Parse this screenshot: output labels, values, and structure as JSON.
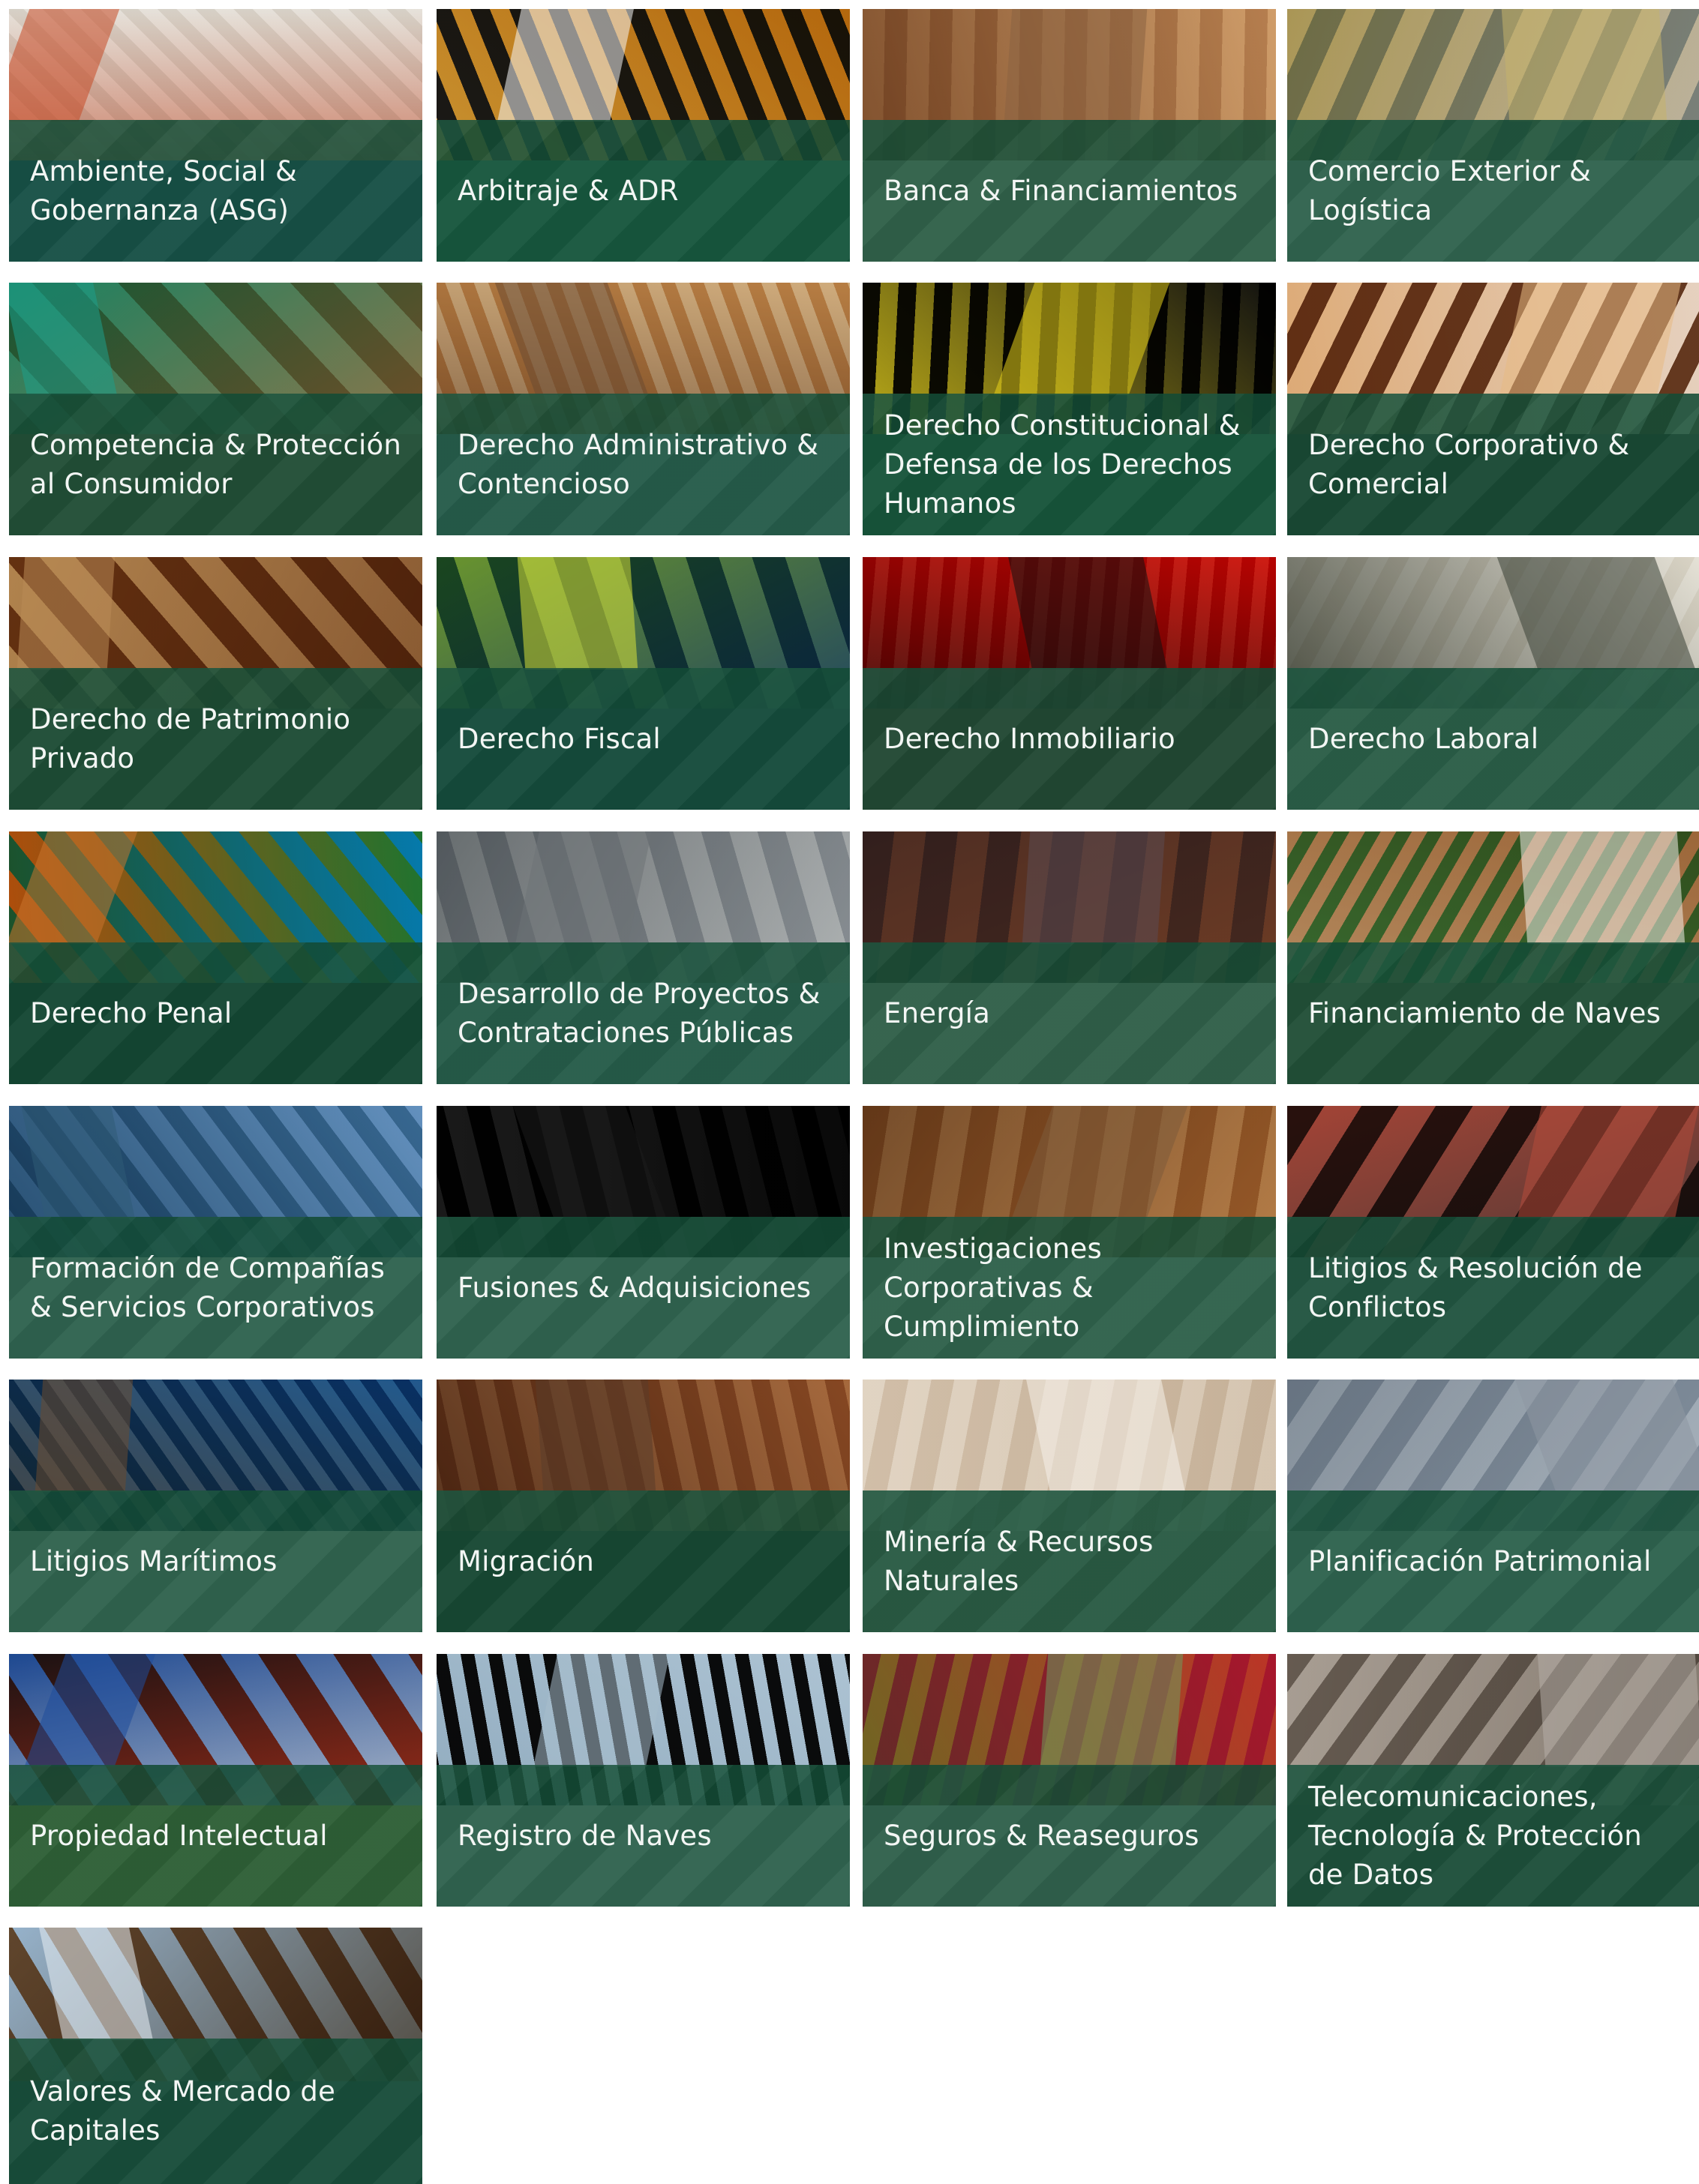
{
  "practice_areas": [
    {
      "label": "Ambiente, Social & Gobernanza (ASG)",
      "image_icon": "texture-mosaic-icon",
      "colors": [
        "#f2f0ec",
        "#e2ded7",
        "#c64a27",
        "#2d5fa8"
      ]
    },
    {
      "label": "Arbitraje & ADR",
      "image_icon": "halftone-stripes-icon",
      "colors": [
        "#d6a23a",
        "#1c1c1c",
        "#f4f4f4",
        "#2f8a66"
      ]
    },
    {
      "label": "Banca & Financiamientos",
      "image_icon": "wood-panel-icon",
      "colors": [
        "#e6c8a4",
        "#caa27b",
        "#8a6242",
        "#f2dcc1"
      ]
    },
    {
      "label": "Comercio Exterior & Logística",
      "image_icon": "architecture-icon",
      "colors": [
        "#dcd7cc",
        "#8e9aa0",
        "#c5b26b",
        "#f3f1ea"
      ]
    },
    {
      "label": "Competencia & Protección al Consumidor",
      "image_icon": "sculpture-icon",
      "colors": [
        "#b98c61",
        "#e8d0b3",
        "#1d9f8a",
        "#7a4d2f"
      ]
    },
    {
      "label": "Derecho Administrativo & Contencioso",
      "image_icon": "skylight-icon",
      "colors": [
        "#d8b383",
        "#f5f5f2",
        "#6c4a32",
        "#9ab6cf"
      ]
    },
    {
      "label": "Derecho Constitucional & Defensa de los Derechos Humanos",
      "image_icon": "stripes-icon",
      "colors": [
        "#111111",
        "#f5f5f5",
        "#e7d21b",
        "#2a7a4e"
      ]
    },
    {
      "label": "Derecho Corporativo & Comercial",
      "image_icon": "chandelier-icon",
      "colors": [
        "#f2e7dd",
        "#6a3f25",
        "#e8b983",
        "#3a2418"
      ]
    },
    {
      "label": "Derecho de Patrimonio Privado",
      "image_icon": "pattern-icon",
      "colors": [
        "#8a5a33",
        "#f4f1ea",
        "#b98b55",
        "#5e3a22"
      ]
    },
    {
      "label": "Derecho Fiscal",
      "image_icon": "building-glass-icon",
      "colors": [
        "#1f4f87",
        "#7da7c9",
        "#d7e23a",
        "#1a3050"
      ]
    },
    {
      "label": "Derecho Inmobiliario",
      "image_icon": "abstract-paint-icon",
      "colors": [
        "#d81f16",
        "#f5f0e9",
        "#111111",
        "#7a1a14"
      ]
    },
    {
      "label": "Derecho Laboral",
      "image_icon": "wall-icon",
      "colors": [
        "#f2f0ea",
        "#e6e2d8",
        "#3b4136",
        "#c7c0b3"
      ]
    },
    {
      "label": "Derecho Penal",
      "image_icon": "geometric-tiles-icon",
      "colors": [
        "#24b0d1",
        "#e3a739",
        "#c9742e",
        "#111111"
      ]
    },
    {
      "label": "Desarrollo de Proyectos & Contrataciones Públicas",
      "image_icon": "lobby-icon",
      "colors": [
        "#bfc3c6",
        "#f2f2ef",
        "#6d7377",
        "#9eb4c6"
      ]
    },
    {
      "label": "Energía",
      "image_icon": "triangles-icon",
      "colors": [
        "#8c6a5a",
        "#d99b6b",
        "#5b4a52",
        "#f1d7c2"
      ]
    },
    {
      "label": "Financiamiento de Naves",
      "image_icon": "plants-icon",
      "colors": [
        "#c7a178",
        "#3e7b3c",
        "#f2efe7",
        "#7c5435"
      ]
    },
    {
      "label": "Formación de Compañías & Servicios Corporativos",
      "image_icon": "office-building-icon",
      "colors": [
        "#9fc0dc",
        "#5a8aa8",
        "#2f5b76",
        "#e8eef3"
      ]
    },
    {
      "label": "Fusiones & Adquisiciones",
      "image_icon": "swirls-icon",
      "colors": [
        "#0a0a0a",
        "#f0f0f0",
        "#1c1c1c",
        "#f7f7f7"
      ]
    },
    {
      "label": "Investigaciones Corporativas & Cumplimiento",
      "image_icon": "columns-icon",
      "colors": [
        "#c99b68",
        "#f0d8b8",
        "#7d5b3b",
        "#e8e3d5"
      ]
    },
    {
      "label": "Litigios & Resolución de Conflictos",
      "image_icon": "bricks-icon",
      "colors": [
        "#3a3a3a",
        "#e8e8e8",
        "#b44b3b",
        "#7b7b7b"
      ]
    },
    {
      "label": "Litigios Marítimos",
      "image_icon": "glass-roof-icon",
      "colors": [
        "#2f6f9f",
        "#b8cde2",
        "#6a4b2f",
        "#f0f0ee"
      ]
    },
    {
      "label": "Migración",
      "image_icon": "wood-slots-icon",
      "colors": [
        "#b9875e",
        "#e5c7a6",
        "#5a3c2a",
        "#2c1d17"
      ]
    },
    {
      "label": "Minería & Recursos Naturales",
      "image_icon": "stone-wall-icon",
      "colors": [
        "#e9e0d4",
        "#d8c9b7",
        "#f6f1ea",
        "#b9a893"
      ]
    },
    {
      "label": "Planificación Patrimonial",
      "image_icon": "curve-icon",
      "colors": [
        "#b9c2cb",
        "#eef1f3",
        "#8e98a2",
        "#e4e8ea"
      ]
    },
    {
      "label": "Propiedad Intelectual",
      "image_icon": "artwork-icon",
      "colors": [
        "#f1f1ef",
        "#d83a1e",
        "#1f4c9a",
        "#e6d12a"
      ]
    },
    {
      "label": "Registro de Naves",
      "image_icon": "curves-icon",
      "colors": [
        "#d2dfe8",
        "#0d0d0d",
        "#a7bdcc",
        "#f4f4f4"
      ]
    },
    {
      "label": "Seguros & Reaseguros",
      "image_icon": "floral-icon",
      "colors": [
        "#cf4b6a",
        "#e7b25d",
        "#6f9b5c",
        "#f3d8d8"
      ]
    },
    {
      "label": "Telecomunicaciones, Tecnología & Protección de Datos",
      "image_icon": "lattice-icon",
      "colors": [
        "#8f867d",
        "#ece8e3",
        "#b5ada5",
        "#5a524b"
      ]
    },
    {
      "label": "Valores & Mercado de Capitales",
      "image_icon": "glass-dome-icon",
      "colors": [
        "#6a4b2f",
        "#a6bfd4",
        "#e7eef4",
        "#35404a"
      ]
    }
  ]
}
